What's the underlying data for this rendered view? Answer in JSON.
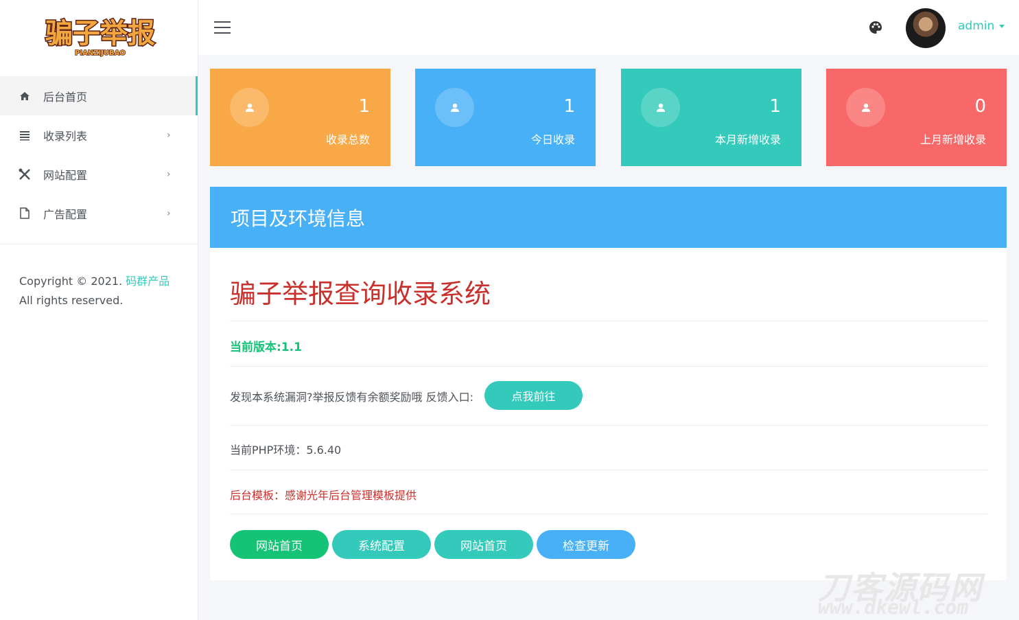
{
  "logo": {
    "main_text": "骗子举报",
    "sub_text": "PIANZIJUBAO"
  },
  "sidebar": {
    "items": [
      {
        "label": "后台首页",
        "icon": "home-icon",
        "active": true
      },
      {
        "label": "收录列表",
        "icon": "list-icon",
        "arrow": "›"
      },
      {
        "label": "网站配置",
        "icon": "tools-icon",
        "arrow": "›"
      },
      {
        "label": "广告配置",
        "icon": "file-icon",
        "arrow": "›"
      }
    ],
    "copyright_prefix": "Copyright © 2021. ",
    "copyright_brand": "码群产品",
    "copyright_suffix": " All rights reserved."
  },
  "header": {
    "menu_icon": "hamburger-icon",
    "theme_icon": "palette-icon",
    "username": "admin"
  },
  "stats": [
    {
      "value": "1",
      "label": "收录总数",
      "color": "#f9a847"
    },
    {
      "value": "1",
      "label": "今日收录",
      "color": "#48b0f7"
    },
    {
      "value": "1",
      "label": "本月新增收录",
      "color": "#33cabb"
    },
    {
      "value": "0",
      "label": "上月新增收录",
      "color": "#f96868"
    }
  ],
  "info": {
    "heading": "项目及环境信息",
    "system_title": "骗子举报查询收录系统",
    "version": "当前版本:1.1",
    "feedback_text": "发现本系统漏洞?举报反馈有余额奖励哦 反馈入口:",
    "feedback_button": "点我前往",
    "php_env": "当前PHP环境：5.6.40",
    "template_note": "后台模板：感谢光年后台管理模板提供",
    "buttons": [
      {
        "label": "网站首页",
        "color": "#15c377"
      },
      {
        "label": "系统配置",
        "color": "#33cabb"
      },
      {
        "label": "网站首页",
        "color": "#33cabb"
      },
      {
        "label": "检查更新",
        "color": "#48b0f7"
      }
    ]
  },
  "watermark": {
    "line1": "刀客源码网",
    "line2": "www.dkewl.com"
  }
}
